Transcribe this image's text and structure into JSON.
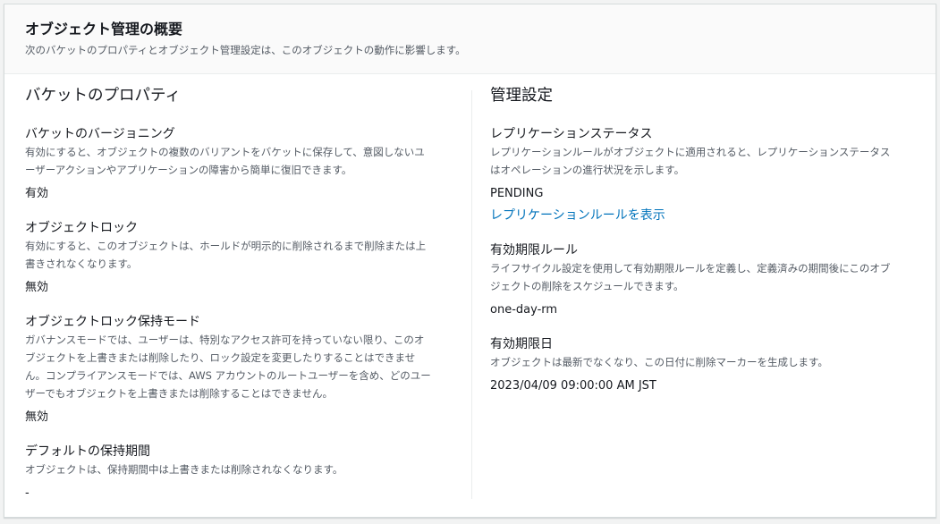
{
  "header": {
    "title": "オブジェクト管理の概要",
    "description": "次のバケットのプロパティとオブジェクト管理設定は、このオブジェクトの動作に影響します。"
  },
  "left": {
    "heading": "バケットのプロパティ",
    "versioning": {
      "label": "バケットのバージョニング",
      "desc1": "有効にすると、オブジェクトの複数のバリアントをバケットに保存して、意図しないユ",
      "desc2": "ーザーアクションやアプリケーションの障害から簡単に復旧できます。",
      "value": "有効"
    },
    "object_lock": {
      "label": "オブジェクトロック",
      "desc1": "有効にすると、このオブジェクトは、ホールドが明示的に削除されるまで削除または上",
      "desc2": "書きされなくなります。",
      "value": "無効"
    },
    "lock_mode": {
      "label": "オブジェクトロック保持モード",
      "desc1": "ガバナンスモードでは、ユーザーは、特別なアクセス許可を持っていない限り、このオ",
      "desc2": "ブジェクトを上書きまたは削除したり、ロック設定を変更したりすることはできませ",
      "desc3": "ん。コンプライアンスモードでは、AWS アカウントのルートユーザーを含め、どのユー",
      "desc4": "ザーでもオブジェクトを上書きまたは削除することはできません。",
      "value": "無効"
    },
    "retention": {
      "label": "デフォルトの保持期間",
      "desc1": "オブジェクトは、保持期間中は上書きまたは削除されなくなります。",
      "value": "-"
    }
  },
  "right": {
    "heading": "管理設定",
    "replication": {
      "label": "レプリケーションステータス",
      "desc1": "レプリケーションルールがオブジェクトに適用されると、レプリケーションステータス",
      "desc2": "はオペレーションの進行状況を示します。",
      "value": "PENDING",
      "link": "レプリケーションルールを表示"
    },
    "expiration_rule": {
      "label": "有効期限ルール",
      "desc1": "ライフサイクル設定を使用して有効期限ルールを定義し、定義済みの期間後にこのオブ",
      "desc2": "ジェクトの削除をスケジュールできます。",
      "value": "one-day-rm"
    },
    "expiration_date": {
      "label": "有効期限日",
      "desc1": "オブジェクトは最新でなくなり、この日付に削除マーカーを生成します。",
      "value": "2023/04/09 09:00:00 AM JST"
    }
  },
  "colors": {
    "link": "#0073bb",
    "secondary_text": "#545b64",
    "primary_text": "#16191f"
  }
}
